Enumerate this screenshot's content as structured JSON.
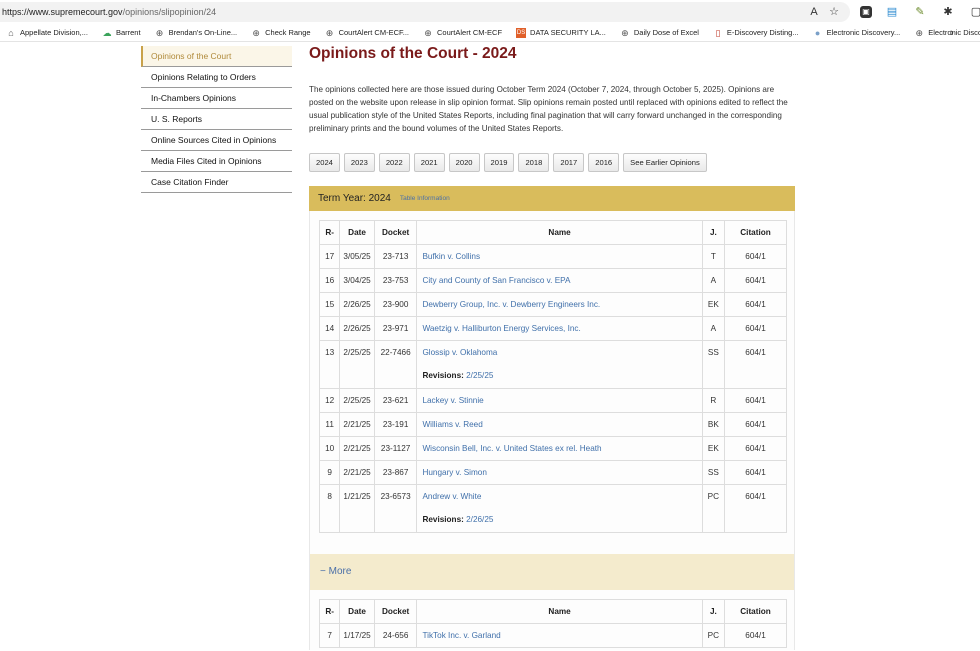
{
  "browser": {
    "url_host": "https://www.supremecourt.gov",
    "url_path": "/opinions/slipopinion/24",
    "bookmarks": [
      {
        "label": "Appellate Division,...",
        "icon": "building-icon"
      },
      {
        "label": "Barrent",
        "icon": "cloud-icon"
      },
      {
        "label": "Brendan's On-Line...",
        "icon": "globe-icon"
      },
      {
        "label": "Check Range",
        "icon": "globe-icon"
      },
      {
        "label": "CourtAlert CM-ECF...",
        "icon": "globe-icon"
      },
      {
        "label": "CourtAlert CM-ECF",
        "icon": "globe-icon"
      },
      {
        "label": "DATA SECURITY LA...",
        "icon": "ds-icon"
      },
      {
        "label": "Daily Dose of Excel",
        "icon": "globe-icon"
      },
      {
        "label": "E-Discovery Disting...",
        "icon": "page-icon"
      },
      {
        "label": "Electronic Discovery...",
        "icon": "circle-icon"
      },
      {
        "label": "Electronic Discovery...",
        "icon": "globe-icon"
      }
    ]
  },
  "sidebar": {
    "items": [
      {
        "label": "Opinions of the Court",
        "active": true
      },
      {
        "label": "Opinions Relating to Orders"
      },
      {
        "label": "In-Chambers Opinions"
      },
      {
        "label": "U. S. Reports"
      },
      {
        "label": "Online Sources Cited in Opinions"
      },
      {
        "label": "Media Files Cited in Opinions"
      },
      {
        "label": "Case Citation Finder"
      }
    ]
  },
  "main": {
    "title": "Opinions of the Court - 2024",
    "intro": "The opinions collected here are those issued during October Term 2024 (October 7, 2024, through October 5, 2025). Opinions are posted on the website upon release in slip opinion format. Slip opinions remain posted until replaced with opinions edited to reflect the usual publication style of the United States Reports, including final pagination that will carry forward unchanged in the corresponding preliminary prints and the bound volumes of the United States Reports.",
    "year_buttons": [
      "2024",
      "2023",
      "2022",
      "2021",
      "2020",
      "2019",
      "2018",
      "2017",
      "2016",
      "See Earlier Opinions"
    ],
    "term_title": "Term Year: 2024",
    "term_info": "Table Information",
    "columns": [
      "R-",
      "Date",
      "Docket",
      "Name",
      "J.",
      "Citation"
    ],
    "revisions_label": "Revisions:",
    "rows": [
      {
        "r": "17",
        "date": "3/05/25",
        "docket": "23-713",
        "name": "Bufkin v. Collins",
        "j": "T",
        "citation": "604/1"
      },
      {
        "r": "16",
        "date": "3/04/25",
        "docket": "23-753",
        "name": "City and County of San Francisco v. EPA",
        "j": "A",
        "citation": "604/1"
      },
      {
        "r": "15",
        "date": "2/26/25",
        "docket": "23-900",
        "name": "Dewberry Group, Inc. v. Dewberry Engineers Inc.",
        "j": "EK",
        "citation": "604/1"
      },
      {
        "r": "14",
        "date": "2/26/25",
        "docket": "23-971",
        "name": "Waetzig v. Halliburton Energy Services, Inc.",
        "j": "A",
        "citation": "604/1"
      },
      {
        "r": "13",
        "date": "2/25/25",
        "docket": "22-7466",
        "name": "Glossip v. Oklahoma",
        "j": "SS",
        "citation": "604/1",
        "revision": "2/25/25"
      },
      {
        "r": "12",
        "date": "2/25/25",
        "docket": "23-621",
        "name": "Lackey v. Stinnie",
        "j": "R",
        "citation": "604/1"
      },
      {
        "r": "11",
        "date": "2/21/25",
        "docket": "23-191",
        "name": "Williams v. Reed",
        "j": "BK",
        "citation": "604/1"
      },
      {
        "r": "10",
        "date": "2/21/25",
        "docket": "23-1127",
        "name": "Wisconsin Bell, Inc. v. United States ex rel. Heath",
        "j": "EK",
        "citation": "604/1"
      },
      {
        "r": "9",
        "date": "2/21/25",
        "docket": "23-867",
        "name": "Hungary v. Simon",
        "j": "SS",
        "citation": "604/1"
      },
      {
        "r": "8",
        "date": "1/21/25",
        "docket": "23-6573",
        "name": "Andrew v. White",
        "j": "PC",
        "citation": "604/1",
        "revision": "2/26/25"
      }
    ],
    "more_label": "− More",
    "rows2": [
      {
        "r": "7",
        "date": "1/17/25",
        "docket": "24-656",
        "name": "TikTok Inc. v. Garland",
        "j": "PC",
        "citation": "604/1"
      }
    ]
  }
}
